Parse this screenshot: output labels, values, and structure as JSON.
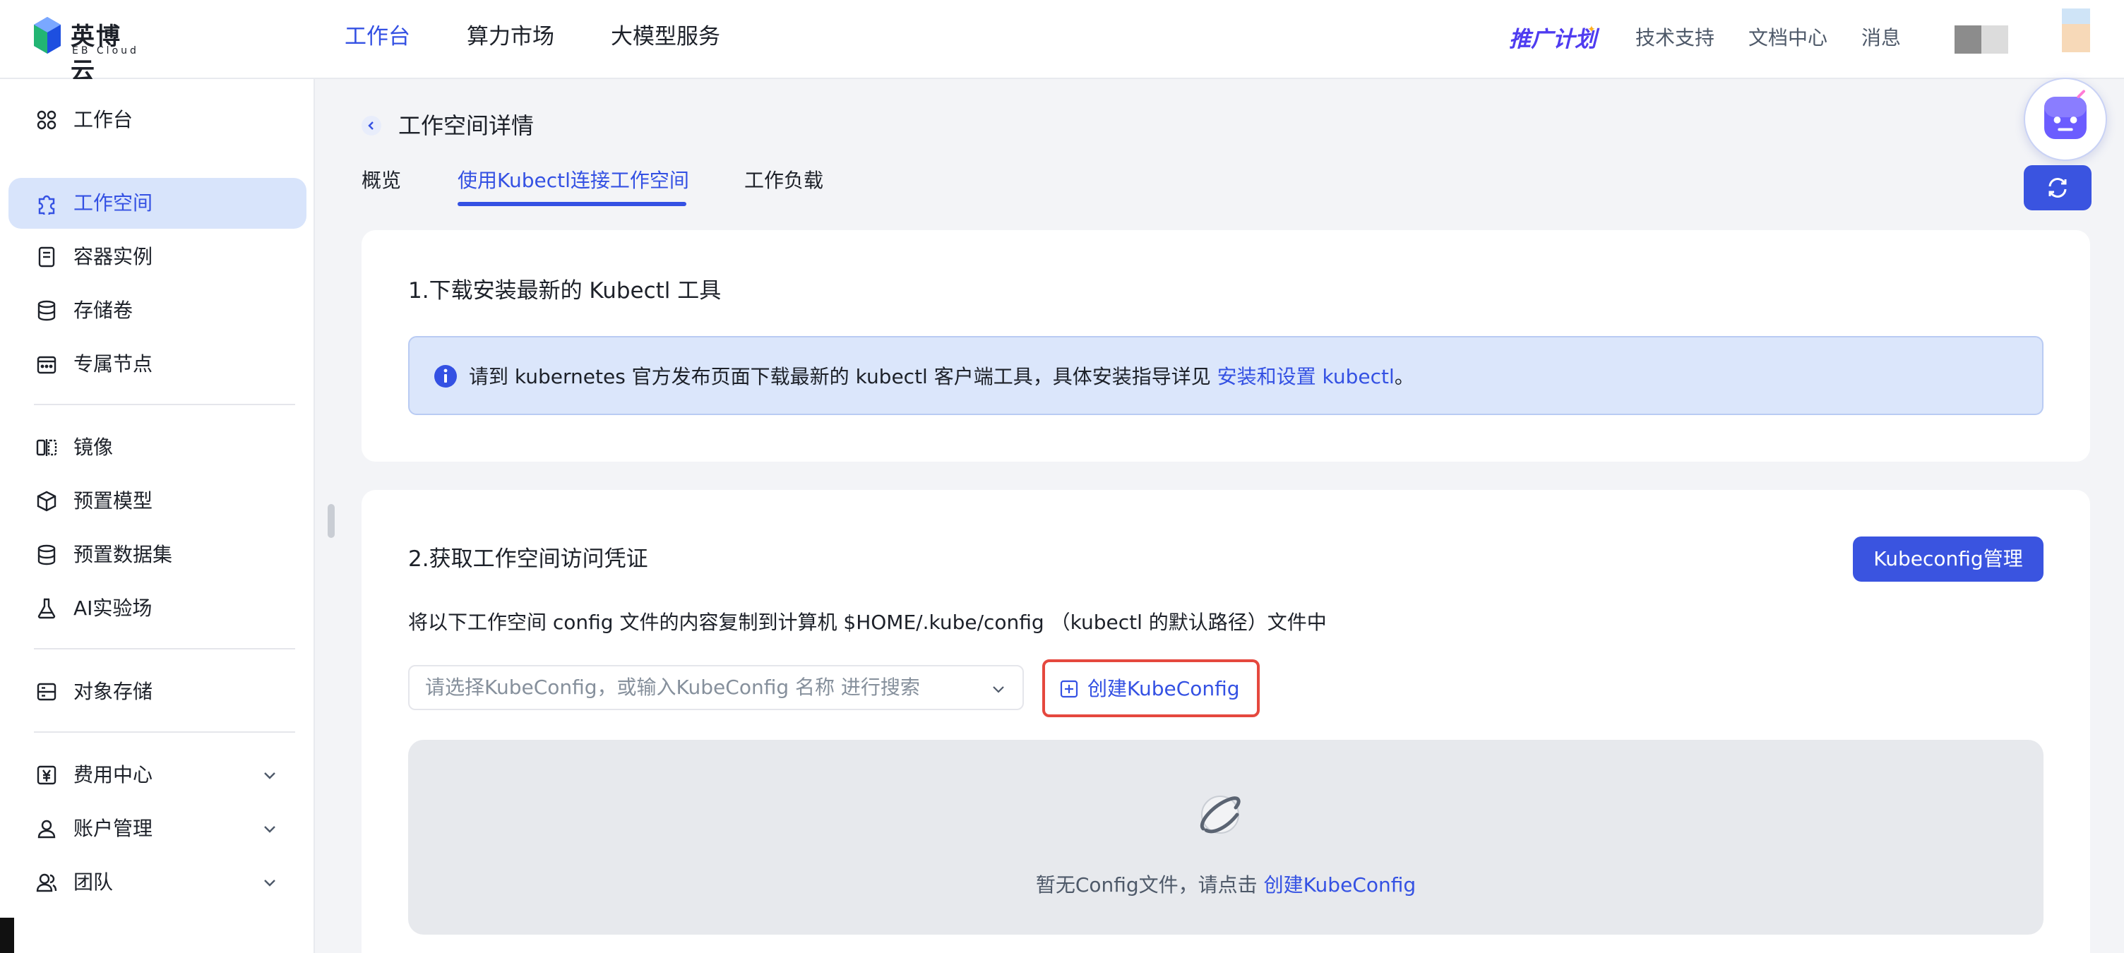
{
  "brand": {
    "name": "英博云",
    "sub": "EB Cloud",
    "colors": {
      "primary": "#3451e3",
      "logo_blue": "#2f6bff",
      "logo_green": "#22b573"
    }
  },
  "topnav": {
    "items": [
      {
        "label": "工作台",
        "active": true
      },
      {
        "label": "算力市场",
        "active": false
      },
      {
        "label": "大模型服务",
        "active": false
      }
    ]
  },
  "topright": {
    "promo": "推广计划",
    "links": [
      "技术支持",
      "文档中心",
      "消息"
    ]
  },
  "sidebar": {
    "items": [
      {
        "label": "工作台",
        "icon": "grid-icon"
      },
      {
        "label": "工作空间",
        "icon": "puzzle-icon",
        "active": true
      },
      {
        "label": "容器实例",
        "icon": "container-icon"
      },
      {
        "label": "存储卷",
        "icon": "database-icon"
      },
      {
        "label": "专属节点",
        "icon": "calendar-node-icon"
      },
      {
        "label": "镜像",
        "icon": "mirror-icon"
      },
      {
        "label": "预置模型",
        "icon": "cube-icon"
      },
      {
        "label": "预置数据集",
        "icon": "dataset-icon"
      },
      {
        "label": "AI实验场",
        "icon": "flask-icon"
      },
      {
        "label": "对象存储",
        "icon": "object-storage-icon"
      },
      {
        "label": "费用中心",
        "icon": "yen-icon",
        "expandable": true
      },
      {
        "label": "账户管理",
        "icon": "user-icon",
        "expandable": true
      },
      {
        "label": "团队",
        "icon": "team-icon",
        "expandable": true
      }
    ]
  },
  "page": {
    "title": "工作空间详情",
    "tabs": [
      {
        "label": "概览",
        "active": false
      },
      {
        "label": "使用Kubectl连接工作空间",
        "active": true
      },
      {
        "label": "工作负载",
        "active": false
      }
    ]
  },
  "section1": {
    "heading": "1.下载安装最新的 Kubectl 工具",
    "info_text": "请到 kubernetes 官方发布页面下载最新的 kubectl 客户端工具，具体安装指导详见 ",
    "info_link": "安装和设置 kubectl",
    "info_suffix": "。"
  },
  "section2": {
    "heading": "2.获取工作空间访问凭证",
    "manage_button": "Kubeconfig管理",
    "description": "将以下工作空间 config 文件的内容复制到计算机 $HOME/.kube/config （kubectl 的默认路径）文件中",
    "select_placeholder": "请选择KubeConfig，或输入KubeConfig 名称 进行搜索",
    "create_button": "创建KubeConfig",
    "empty_text": "暂无Config文件，请点击 ",
    "empty_link": "创建KubeConfig"
  }
}
